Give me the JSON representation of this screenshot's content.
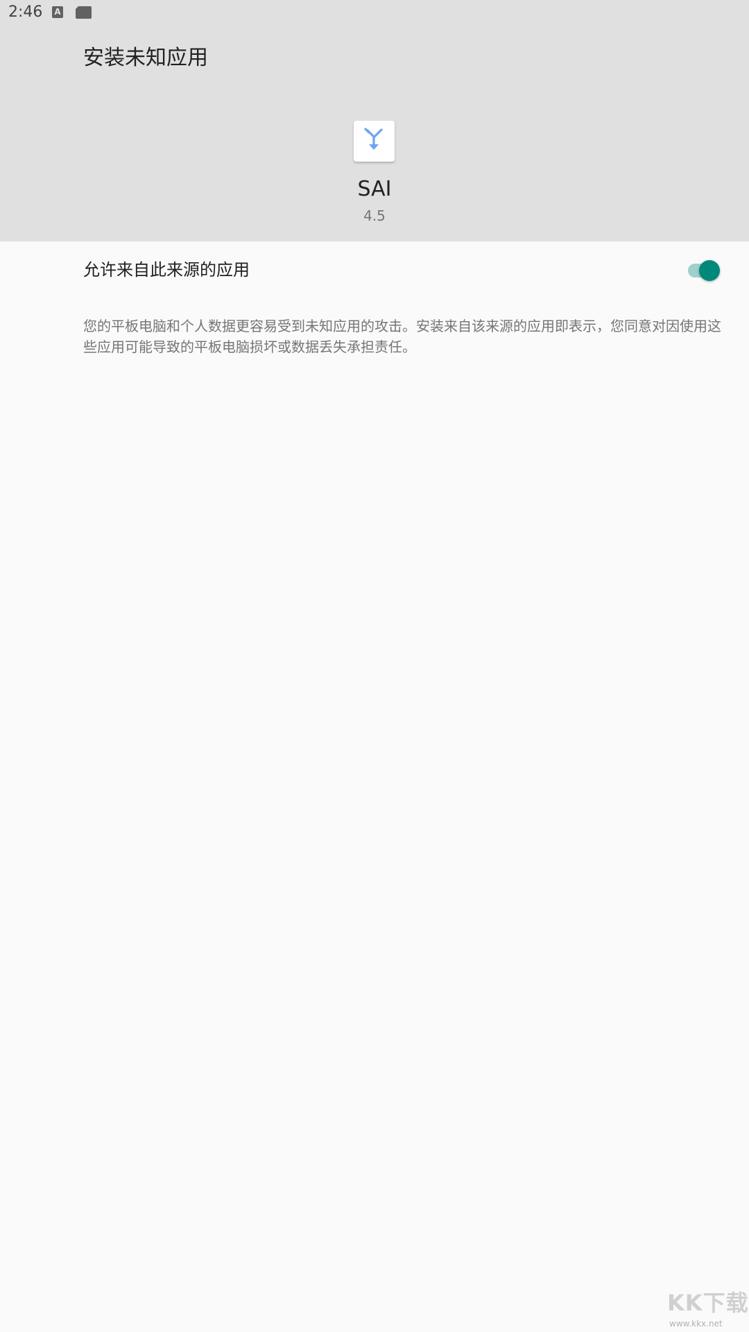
{
  "status_bar": {
    "time": "2:46",
    "icons": [
      "a-notification-icon",
      "sd-card-icon"
    ],
    "a_icon_letter": "A"
  },
  "header": {
    "title": "安装未知应用",
    "background_color": "#e0e0e0"
  },
  "app": {
    "name": "SAI",
    "version": "4.5",
    "icon": "merge-arrow-icon",
    "icon_color": "#6ea3f0"
  },
  "setting": {
    "label": "允许来自此来源的应用",
    "enabled": true,
    "accent_color": "#00897b"
  },
  "warning": {
    "text": "您的平板电脑和个人数据更容易受到未知应用的攻击。安装来自该来源的应用即表示，您同意对因使用这些应用可能导致的平板电脑损坏或数据丢失承担责任。"
  },
  "watermark": {
    "logo": "KK下载",
    "url": "www.kkx.net"
  }
}
